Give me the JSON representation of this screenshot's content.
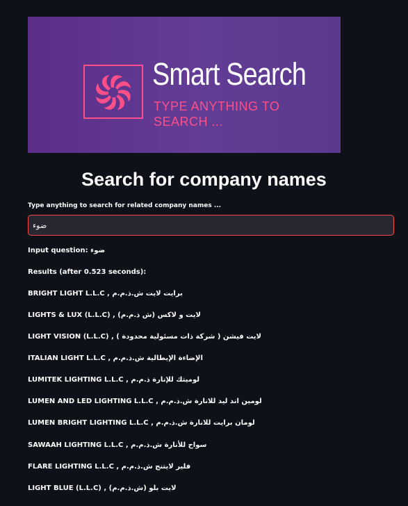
{
  "banner": {
    "title": "Smart Search",
    "subtitle": "TYPE ANYTHING TO\nSEARCH ...",
    "accent_color": "#ff4f88",
    "background_color": "#5f3590",
    "logo_icon": "pinwheel-logo-icon"
  },
  "page": {
    "heading": "Search for company names"
  },
  "search": {
    "label": "Type anything to search for related company names ...",
    "value": "ضوء",
    "border_color": "#ff4b4b"
  },
  "query": {
    "text": "Input question: ضوء"
  },
  "results": {
    "header": "Results (after 0.523 seconds):",
    "items": [
      "BRIGHT LIGHT L.L.C , برايت لايت ش.ذ.م.م",
      "LIGHTS & LUX (L.L.C) , (لايت و لاكس (ش ذ.م.م",
      "LIGHT VISION (L.L.C) , ( لايت فيشن ( شركة ذات مسئولية محدودة",
      "ITALIAN LIGHT L.L.C , الإضاءة الإيطالية ش.ذ.م.م",
      "LUMITEK LIGHTING L.L.C , لوميتك للإنارة ذ.م.م",
      "LUMEN AND LED LIGHTING L.L.C , لومين اند ليد للانارة ش.ذ.م.م",
      "LUMEN BRIGHT LIGHTING L.L.C , لومان برايت للانارة ش.ذ.م.م",
      "SAWAAH LIGHTING L.L.C , سواح للأنارة ش.ذ.م.م",
      "FLARE LIGHTING L.L.C , فلير لايتنج ش.ذ.م.م",
      "LIGHT BLUE (L.L.C) , (لايت بلو (ش.ذ.م.م"
    ]
  }
}
